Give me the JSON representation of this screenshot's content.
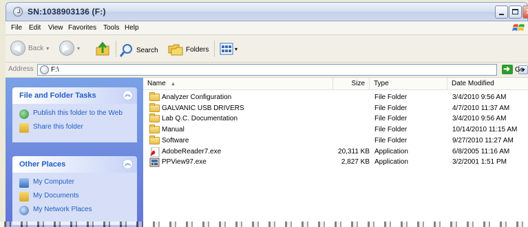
{
  "window": {
    "title": "SN:1038903136 (F:)"
  },
  "menu": [
    "File",
    "Edit",
    "View",
    "Favorites",
    "Tools",
    "Help"
  ],
  "toolbar": {
    "back_label": "Back",
    "search_label": "Search",
    "folders_label": "Folders"
  },
  "address": {
    "label": "Address",
    "value": "F:\\",
    "go_label": "Go"
  },
  "tasks": {
    "file_folder": {
      "title": "File and Folder Tasks",
      "items": [
        "Publish this folder to the Web",
        "Share this folder"
      ]
    },
    "other_places": {
      "title": "Other Places",
      "items": [
        "My Computer",
        "My Documents",
        "My Network Places"
      ]
    }
  },
  "columns": {
    "name": "Name",
    "size": "Size",
    "type": "Type",
    "date": "Date Modified"
  },
  "files": [
    {
      "icon": "folder-icon",
      "name": "Analyzer Configuration",
      "size": "",
      "type": "File Folder",
      "date": "3/4/2010 9:56 AM"
    },
    {
      "icon": "folder-icon",
      "name": "GALVANIC USB DRIVERS",
      "size": "",
      "type": "File Folder",
      "date": "4/7/2010 11:37 AM"
    },
    {
      "icon": "folder-icon",
      "name": "Lab Q.C. Documentation",
      "size": "",
      "type": "File Folder",
      "date": "3/4/2010 9:56 AM"
    },
    {
      "icon": "folder-icon",
      "name": "Manual",
      "size": "",
      "type": "File Folder",
      "date": "10/14/2010 11:15 AM"
    },
    {
      "icon": "folder-icon",
      "name": "Software",
      "size": "",
      "type": "File Folder",
      "date": "9/27/2010 11:27 AM"
    },
    {
      "icon": "adobe-reader-icon",
      "name": "AdobeReader7.exe",
      "size": "20,311 KB",
      "type": "Application",
      "date": "6/8/2005 11:16 AM"
    },
    {
      "icon": "ppview-icon",
      "name": "PPView97.exe",
      "size": "2,827 KB",
      "type": "Application",
      "date": "3/2/2001 1:51 PM"
    }
  ]
}
